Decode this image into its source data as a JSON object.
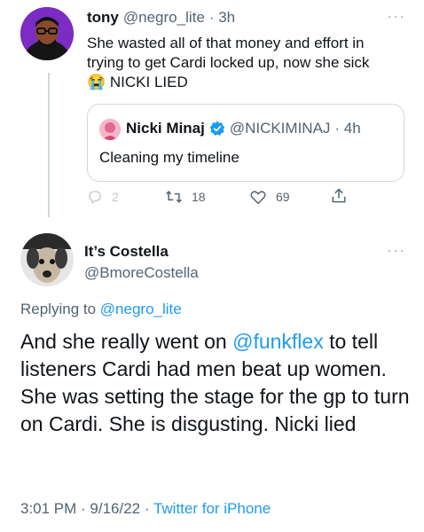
{
  "parent": {
    "name": "tony",
    "handle": "@negro_lite",
    "time": "· 3h",
    "text_line1": "She wasted all of that money and effort in",
    "text_line2": "trying to get Cardi locked up, now she sick",
    "emoji": "😭",
    "text_line3": "NICKI LIED",
    "quote": {
      "name": "Nicki Minaj",
      "handle": "@NICKIMINAJ",
      "time": "· 4h",
      "text": "Cleaning my timeline"
    },
    "actions": {
      "reply_count": "2",
      "retweet_count": "18",
      "like_count": "69"
    },
    "more": "···"
  },
  "main": {
    "name": "It’s Costella",
    "handle": "@BmoreCostella",
    "more": "···",
    "replying_prefix": "Replying to",
    "replying_handle": "@negro_lite",
    "text": {
      "part1": "And she really went on ",
      "mention": "@funkflex",
      "part2": " to tell listeners Cardi had men beat up women. She was setting the stage for the gp to turn on Cardi. She is disgusting. Nicki lied"
    },
    "timestamp": "3:01 PM · 9/16/22 · ",
    "source": "Twitter for iPhone"
  },
  "colors": {
    "accent": "#1d9bf0",
    "verified": "#1d9bf0",
    "text_secondary": "#536471",
    "border": "#cfd9de"
  }
}
